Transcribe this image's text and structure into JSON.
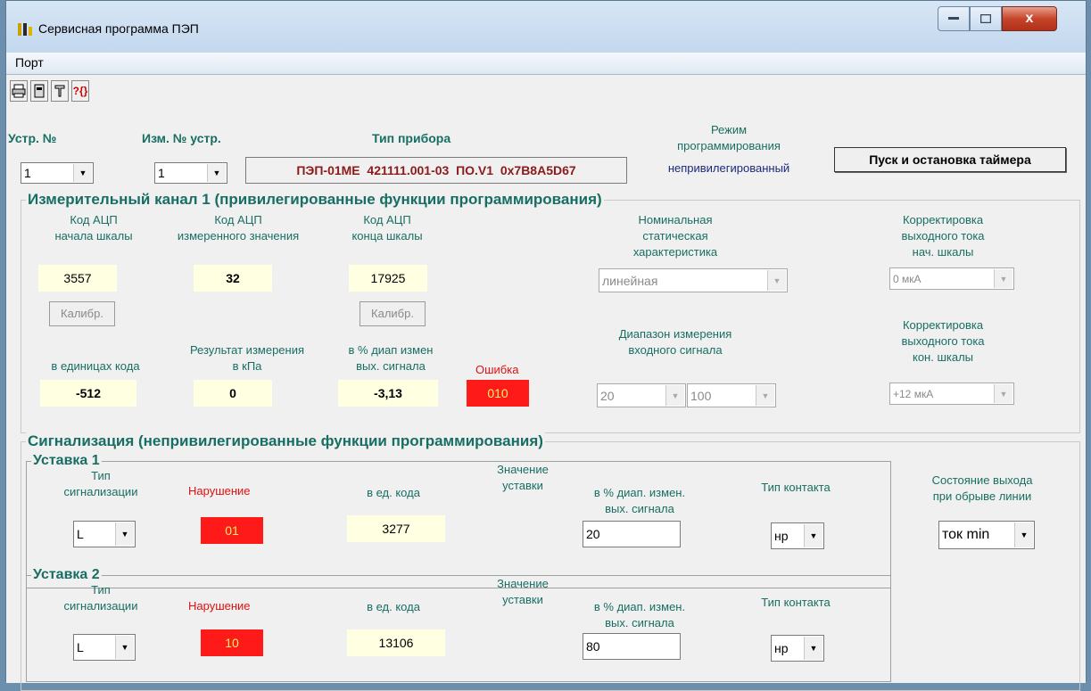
{
  "window": {
    "title": "Сервисная программа ПЭП",
    "close_label": "x"
  },
  "menu": {
    "port": "Порт"
  },
  "toolbar": {
    "icons": [
      "printer-icon",
      "device-icon",
      "tool-icon",
      "help-icon"
    ],
    "help_text": "?{}"
  },
  "header": {
    "dev_no_label": "Устр. №",
    "dev_no_value": "1",
    "meas_dev_no_label": "Изм. № устр.",
    "meas_dev_no_value": "1",
    "device_type_label": "Тип прибора",
    "device_type_value": "ПЭП-01МЕ  421111.001-03  ПО.V1  0x7B8A5D67",
    "mode_label_1": "Режим",
    "mode_label_2": "программирования",
    "mode_value": "непривилегированный",
    "timer_button": "Пуск и остановка таймера"
  },
  "channel": {
    "title": "Измерительный канал  1 (привилегированные функции программирования)",
    "adc_start_l1": "Код АЦП",
    "adc_start_l2": "начала шкалы",
    "adc_start_value": "3557",
    "adc_meas_l1": "Код АЦП",
    "adc_meas_l2": "измеренного значения",
    "adc_meas_value": "32",
    "adc_end_l1": "Код АЦП",
    "adc_end_l2": "конца шкалы",
    "adc_end_value": "17925",
    "calib_label": "Калибр.",
    "nsc_l1": "Номинальная",
    "nsc_l2": "статическая",
    "nsc_l3": "характеристика",
    "nsc_value": "линейная",
    "corr_start_l1": "Корректировка",
    "corr_start_l2": "выходного тока",
    "corr_start_l3": "нач. шкалы",
    "corr_start_value": "0 мкА",
    "units_code_label": "в единицах кода",
    "units_code_value": "-512",
    "result_l1": "Результат измерения",
    "result_l2": "в кПа",
    "result_value": "0",
    "percent_l1": "в % диап измен",
    "percent_l2": "вых. сигнала",
    "percent_value": "-3,13",
    "error_label": "Ошибка",
    "error_value": "010",
    "range_l1": "Диапазон измерения",
    "range_l2": "входного сигнала",
    "range_from": "20",
    "range_to": "100",
    "corr_end_l1": "Корректировка",
    "corr_end_l2": "выходного тока",
    "corr_end_l3": "кон. шкалы",
    "corr_end_value": "+12 мкА"
  },
  "signal": {
    "title": "Сигнализация (непривилегированные функции программирования)",
    "setpoints": [
      {
        "title": "Уставка 1",
        "type_l1": "Тип",
        "type_l2": "сигнализации",
        "type_value": "L",
        "violation_label": "Нарушение",
        "violation_value": "01",
        "code_label": "в ед. кода",
        "code_value": "3277",
        "value_l1": "Значение",
        "value_l2": "уставки",
        "pct_l1": "в % диап. измен.",
        "pct_l2": "вых. сигнала",
        "pct_value": "20",
        "contact_label": "Тип контакта",
        "contact_value": "нр"
      },
      {
        "title": "Уставка 2",
        "type_l1": "Тип",
        "type_l2": "сигнализации",
        "type_value": "L",
        "violation_label": "Нарушение",
        "violation_value": "10",
        "code_label": "в ед. кода",
        "code_value": "13106",
        "value_l1": "Значение",
        "value_l2": "уставки",
        "pct_l1": "в % диап. измен.",
        "pct_l2": "вых. сигнала",
        "pct_value": "80",
        "contact_label": "Тип контакта",
        "contact_value": "нр"
      }
    ],
    "break_state_l1": "Состояние выхода",
    "break_state_l2": "при обрыве линии",
    "break_state_value": "ток min"
  },
  "colors": {
    "label_teal": "#186e62",
    "error_red": "#ff1a1a",
    "field_yellow": "#ffffe1",
    "title_blue": "#bcd3ea"
  }
}
